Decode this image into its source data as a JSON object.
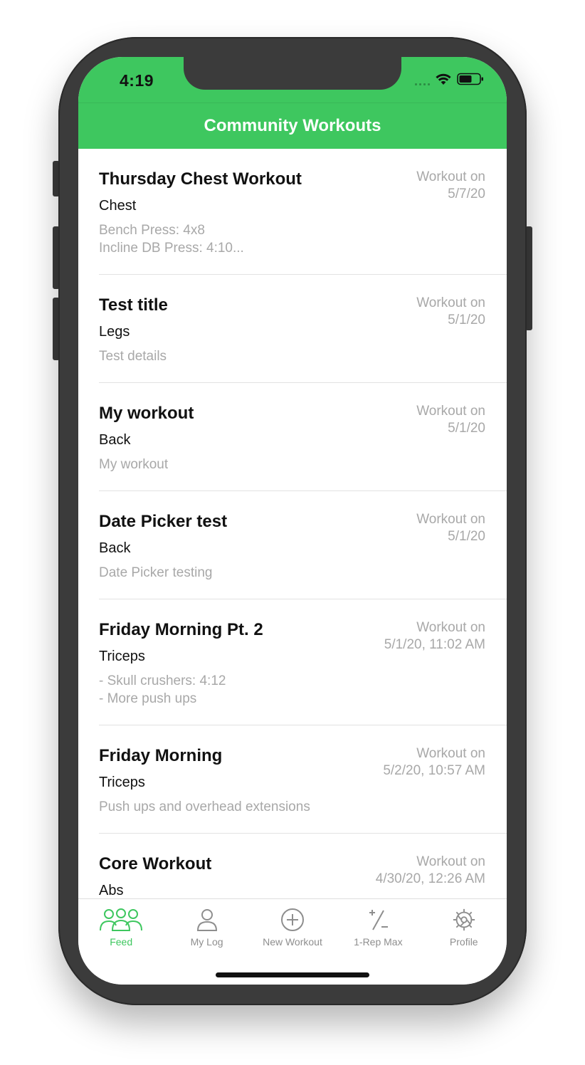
{
  "status_bar": {
    "time": "4:19"
  },
  "header": {
    "title": "Community Workouts"
  },
  "workouts": [
    {
      "title": "Thursday Chest Workout",
      "muscle": "Chest",
      "details": "Bench Press: 4x8\nIncline DB Press: 4:10...",
      "date_label": "Workout on",
      "date": "5/7/20"
    },
    {
      "title": "Test title",
      "muscle": "Legs",
      "details": "Test details",
      "date_label": "Workout on",
      "date": "5/1/20"
    },
    {
      "title": "My workout",
      "muscle": "Back",
      "details": "My workout",
      "date_label": "Workout on",
      "date": "5/1/20"
    },
    {
      "title": "Date Picker test",
      "muscle": "Back",
      "details": "Date Picker testing",
      "date_label": "Workout on",
      "date": "5/1/20"
    },
    {
      "title": "Friday Morning Pt. 2",
      "muscle": "Triceps",
      "details": "- Skull crushers: 4:12\n- More push ups",
      "date_label": "Workout on",
      "date": "5/1/20, 11:02 AM"
    },
    {
      "title": "Friday Morning",
      "muscle": "Triceps",
      "details": "Push ups and overhead extensions",
      "date_label": "Workout on",
      "date": "5/2/20, 10:57 AM"
    },
    {
      "title": "Core Workout",
      "muscle": "Abs",
      "details": "",
      "date_label": "Workout on",
      "date": "4/30/20, 12:26 AM"
    }
  ],
  "tab_bar": {
    "tabs": [
      {
        "label": "Feed",
        "icon": "group-icon",
        "active": true
      },
      {
        "label": "My Log",
        "icon": "person-icon",
        "active": false
      },
      {
        "label": "New Workout",
        "icon": "plus-circle-icon",
        "active": false
      },
      {
        "label": "1-Rep Max",
        "icon": "plus-minus-icon",
        "active": false
      },
      {
        "label": "Profile",
        "icon": "gear-icon",
        "active": false
      }
    ]
  },
  "colors": {
    "accent": "#3ec75f",
    "muted_text": "#a8a8a8",
    "inactive_tab": "#8e8e8e"
  }
}
